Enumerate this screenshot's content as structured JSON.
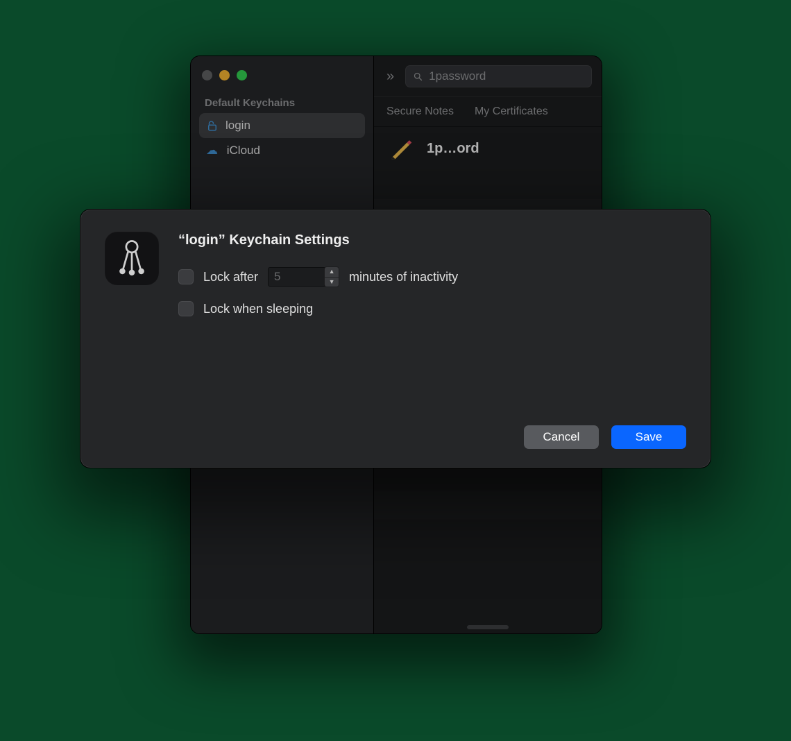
{
  "bg_window": {
    "sidebar": {
      "heading": "Default Keychains",
      "items": [
        {
          "label": "login",
          "selected": true
        }
      ],
      "partial_item_label": "iCloud"
    },
    "toolbar": {
      "search_value": "1password"
    },
    "tabs": [
      "Secure Notes",
      "My Certificates"
    ],
    "item": {
      "title": "1p…ord"
    }
  },
  "dialog": {
    "title": "“login” Keychain Settings",
    "lock_after": {
      "label_before": "Lock after",
      "value": "5",
      "label_after": "minutes of inactivity",
      "checked": false
    },
    "lock_sleep": {
      "label": "Lock when sleeping",
      "checked": false
    },
    "buttons": {
      "cancel": "Cancel",
      "save": "Save"
    }
  }
}
